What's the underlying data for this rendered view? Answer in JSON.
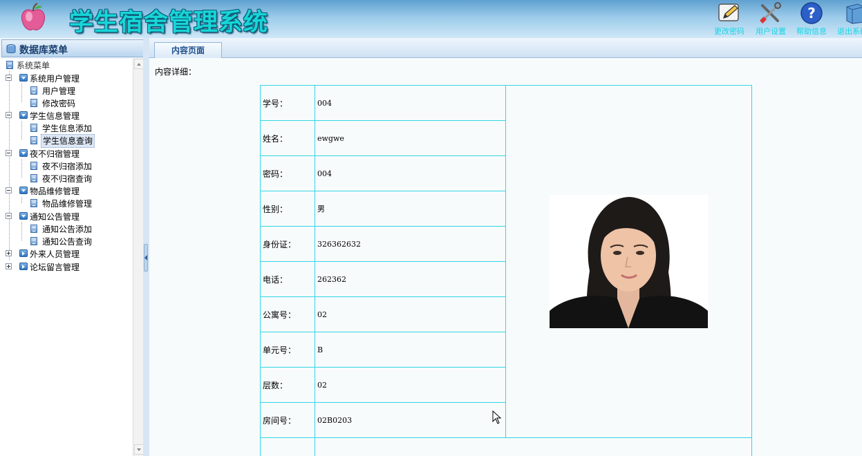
{
  "app": {
    "title": "学生宿舍管理系统"
  },
  "toolbar": {
    "items": [
      {
        "label": "更改密码",
        "icon": "pencil-icon"
      },
      {
        "label": "用户设置",
        "icon": "tools-icon"
      },
      {
        "label": "帮助信息",
        "icon": "help-icon"
      },
      {
        "label": "退出系统",
        "icon": "exit-icon"
      }
    ]
  },
  "sidebar": {
    "title": "数据库菜单",
    "root": "系统菜单",
    "groups": [
      {
        "label": "系统用户管理",
        "items": [
          "用户管理",
          "修改密码"
        ]
      },
      {
        "label": "学生信息管理",
        "items": [
          "学生信息添加",
          "学生信息查询"
        ]
      },
      {
        "label": "夜不归宿管理",
        "items": [
          "夜不归宿添加",
          "夜不归宿查询"
        ]
      },
      {
        "label": "物品维修管理",
        "items": [
          "物品维修管理"
        ]
      },
      {
        "label": "通知公告管理",
        "items": [
          "通知公告添加",
          "通知公告查询"
        ]
      },
      {
        "label": "外来人员管理",
        "items": []
      },
      {
        "label": "论坛留言管理",
        "items": []
      }
    ],
    "selected": "学生信息查询"
  },
  "main": {
    "tab": "内容页面",
    "caption": "内容详细：",
    "fields": [
      {
        "label": "学号：",
        "value": "004"
      },
      {
        "label": "姓名：",
        "value": "ewgwe"
      },
      {
        "label": "密码：",
        "value": "004"
      },
      {
        "label": "性别：",
        "value": "男"
      },
      {
        "label": "身份证：",
        "value": "326362632"
      },
      {
        "label": "电话：",
        "value": "262362"
      },
      {
        "label": "公寓号：",
        "value": "02"
      },
      {
        "label": "单元号：",
        "value": "B"
      },
      {
        "label": "层数：",
        "value": "02"
      },
      {
        "label": "房间号：",
        "value": "02B0203"
      }
    ]
  },
  "colors": {
    "title": "#17d6d6",
    "table_border": "#33d6e6",
    "header_blue": "#5fa0cf"
  }
}
